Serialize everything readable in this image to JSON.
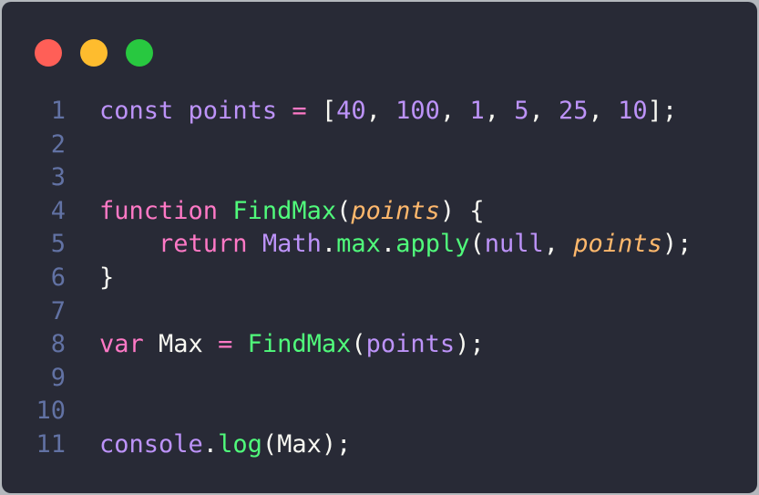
{
  "window": {
    "controls": {
      "close_color": "#ff5f57",
      "minimize_color": "#febc2e",
      "maximize_color": "#28c840"
    }
  },
  "editor": {
    "lines": [
      {
        "number": "1",
        "tokens": [
          {
            "text": "const",
            "type": "dec"
          },
          {
            "text": " ",
            "type": "plain"
          },
          {
            "text": "points",
            "type": "dec"
          },
          {
            "text": " ",
            "type": "plain"
          },
          {
            "text": "=",
            "type": "op"
          },
          {
            "text": " [",
            "type": "plain"
          },
          {
            "text": "40",
            "type": "num"
          },
          {
            "text": ", ",
            "type": "plain"
          },
          {
            "text": "100",
            "type": "num"
          },
          {
            "text": ", ",
            "type": "plain"
          },
          {
            "text": "1",
            "type": "num"
          },
          {
            "text": ", ",
            "type": "plain"
          },
          {
            "text": "5",
            "type": "num"
          },
          {
            "text": ", ",
            "type": "plain"
          },
          {
            "text": "25",
            "type": "num"
          },
          {
            "text": ", ",
            "type": "plain"
          },
          {
            "text": "10",
            "type": "num"
          },
          {
            "text": "];",
            "type": "plain"
          }
        ]
      },
      {
        "number": "2",
        "tokens": []
      },
      {
        "number": "3",
        "tokens": []
      },
      {
        "number": "4",
        "tokens": [
          {
            "text": "function",
            "type": "kw"
          },
          {
            "text": " ",
            "type": "plain"
          },
          {
            "text": "FindMax",
            "type": "fn"
          },
          {
            "text": "(",
            "type": "plain"
          },
          {
            "text": "points",
            "type": "param"
          },
          {
            "text": ") {",
            "type": "plain"
          }
        ]
      },
      {
        "number": "5",
        "tokens": [
          {
            "text": "    ",
            "type": "plain"
          },
          {
            "text": "return",
            "type": "kw"
          },
          {
            "text": " ",
            "type": "plain"
          },
          {
            "text": "Math",
            "type": "obj"
          },
          {
            "text": ".",
            "type": "plain"
          },
          {
            "text": "max",
            "type": "fn"
          },
          {
            "text": ".",
            "type": "plain"
          },
          {
            "text": "apply",
            "type": "fn"
          },
          {
            "text": "(",
            "type": "plain"
          },
          {
            "text": "null",
            "type": "obj"
          },
          {
            "text": ", ",
            "type": "plain"
          },
          {
            "text": "points",
            "type": "param"
          },
          {
            "text": ");",
            "type": "plain"
          }
        ]
      },
      {
        "number": "6",
        "tokens": [
          {
            "text": "}",
            "type": "plain"
          }
        ]
      },
      {
        "number": "7",
        "tokens": []
      },
      {
        "number": "8",
        "tokens": [
          {
            "text": "var",
            "type": "kw"
          },
          {
            "text": " Max ",
            "type": "plain"
          },
          {
            "text": "=",
            "type": "op"
          },
          {
            "text": " ",
            "type": "plain"
          },
          {
            "text": "FindMax",
            "type": "fn"
          },
          {
            "text": "(",
            "type": "plain"
          },
          {
            "text": "points",
            "type": "dec"
          },
          {
            "text": ");",
            "type": "plain"
          }
        ]
      },
      {
        "number": "9",
        "tokens": []
      },
      {
        "number": "10",
        "tokens": []
      },
      {
        "number": "11",
        "tokens": [
          {
            "text": "console",
            "type": "dec"
          },
          {
            "text": ".",
            "type": "plain"
          },
          {
            "text": "log",
            "type": "fn"
          },
          {
            "text": "(Max);",
            "type": "plain"
          }
        ]
      }
    ]
  }
}
